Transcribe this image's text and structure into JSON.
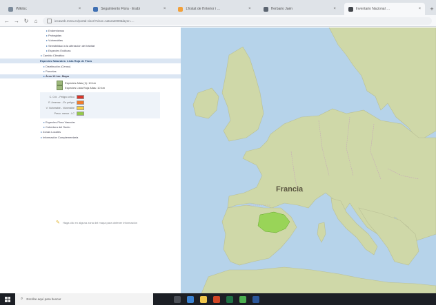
{
  "browser": {
    "tabs": [
      {
        "title": "Wikiloc",
        "color": "#7b8a9a",
        "active": false
      },
      {
        "title": "Seguimiento Flora · Erabi",
        "color": "#3e6fb3",
        "active": false
      },
      {
        "title": "L'Estat de l'Interior i …",
        "color": "#f2a03a",
        "active": false
      },
      {
        "title": "Herbario Jaén",
        "color": "#5b6470",
        "active": false
      },
      {
        "title": "Inventario Nacional …",
        "color": "#43464b",
        "active": true
      }
    ],
    "new_tab_symbol": "+",
    "url": "iecaweb.mma.es/portal-visor/?visor=natura2000&layer=…"
  },
  "sidebar": {
    "tree_top": [
      {
        "label": "Endemismos",
        "indent": 66
      },
      {
        "label": "Protegidas",
        "indent": 66
      },
      {
        "label": "Vulnerables",
        "indent": 66
      },
      {
        "label": "Sensibilidad a la alteración del hábitat",
        "indent": 66
      },
      {
        "label": "Especies Exóticas",
        "indent": 66
      },
      {
        "label": "Cambio Climático",
        "indent": 58
      }
    ],
    "section_header": "Especies Naturales: Lista Roja de Flora",
    "tree_mid": [
      {
        "label": "Distribución (Censo)",
        "indent": 62
      },
      {
        "label": "Parcelas",
        "indent": 62
      },
      {
        "label": "Área 10 km: Mapa",
        "indent": 62,
        "highlight": true
      }
    ],
    "layers": [
      {
        "label": "Especies Atlas (1): 10 km"
      },
      {
        "label": "Especies Lista Roja Atlas: 10 km"
      }
    ],
    "legend": [
      {
        "label": "C. Crít. - Peligro crítico",
        "color": "#d9362b"
      },
      {
        "label": "E. Amenaz. - En peligro",
        "color": "#f07a2a"
      },
      {
        "label": "V. Vulnerable - Vulnerable",
        "color": "#f6cf45"
      },
      {
        "label": "Preoc. menor - LC",
        "color": "#94c84a"
      }
    ],
    "tree_bottom": [
      {
        "label": "Especies Flora Vascular",
        "indent": 62
      },
      {
        "label": "Cobertura del Suelo",
        "indent": 62
      },
      {
        "label": "Zonas Locales",
        "indent": 58
      },
      {
        "label": "Información Complementaria",
        "indent": 58
      }
    ],
    "hint": "Haga clic en alguna zona del mapa para obtener información"
  },
  "map": {
    "label_france": "Francia",
    "land_color": "#cfd8a8",
    "sea_color": "#b6d3ea",
    "highlight_color": "#8fd44a"
  },
  "taskbar": {
    "search_placeholder": "Escribe aquí para buscar",
    "app_icons": [
      {
        "name": "task-view-icon",
        "color": "#4c5058"
      },
      {
        "name": "edge-icon",
        "color": "#3b82d1"
      },
      {
        "name": "file-explorer-icon",
        "color": "#f0c64b"
      },
      {
        "name": "powerpoint-icon",
        "color": "#d24726"
      },
      {
        "name": "excel-icon",
        "color": "#207245"
      },
      {
        "name": "chrome-icon",
        "color": "#4caf50"
      },
      {
        "name": "word-icon",
        "color": "#2b579a"
      }
    ]
  }
}
